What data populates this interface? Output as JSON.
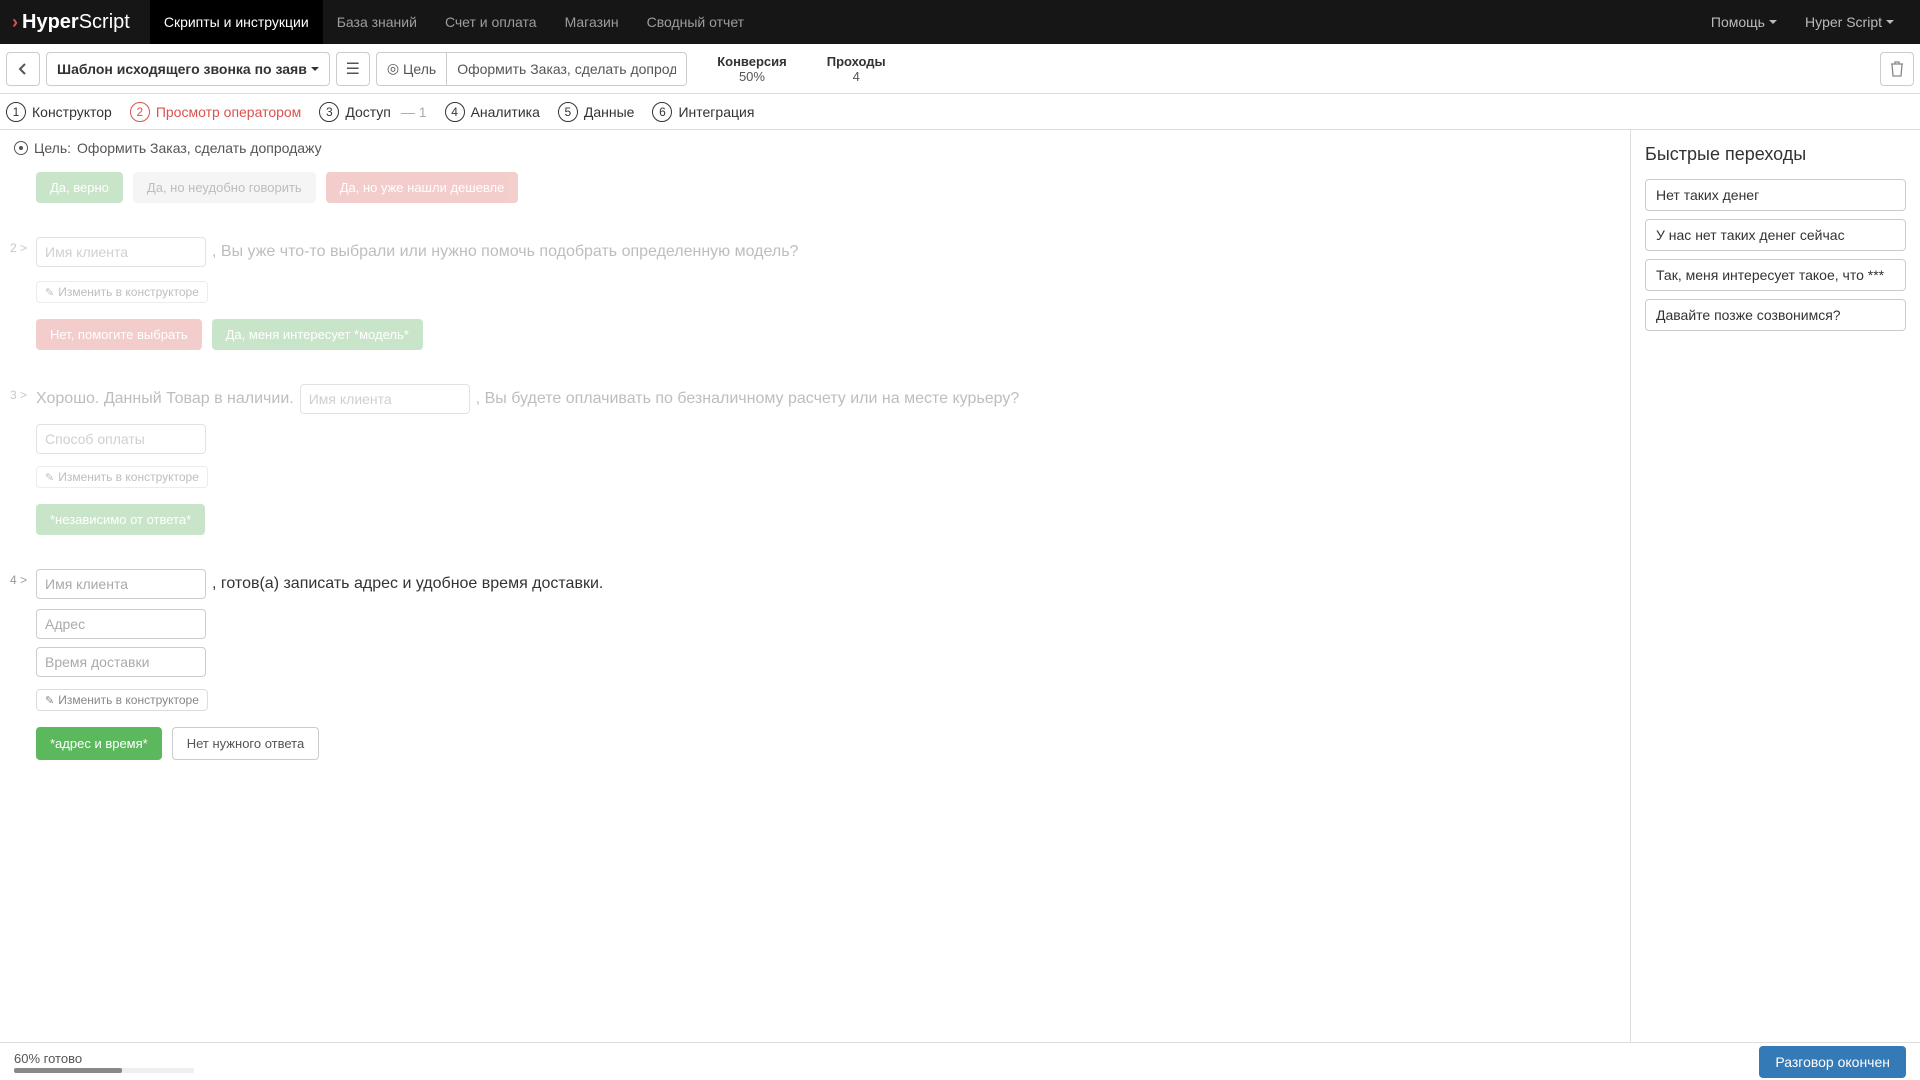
{
  "nav": {
    "logo_bold": "Hyper",
    "logo_light": "Script",
    "items": [
      "Скрипты и инструкции",
      "База знаний",
      "Счет и оплата",
      "Магазин",
      "Сводный отчет"
    ],
    "help": "Помощь",
    "user": "Hyper Script"
  },
  "toolbar": {
    "template_name": "Шаблон исходящего звонка по заяв",
    "goal_label": "Цель",
    "goal_value": "Оформить Заказ, сделать допродажу",
    "stats": {
      "conversion_label": "Конверсия",
      "conversion_value": "50%",
      "passes_label": "Проходы",
      "passes_value": "4"
    }
  },
  "tabs": [
    {
      "num": "1",
      "label": "Конструктор"
    },
    {
      "num": "2",
      "label": "Просмотр оператором"
    },
    {
      "num": "3",
      "label": "Доступ",
      "suffix": "— 1"
    },
    {
      "num": "4",
      "label": "Аналитика"
    },
    {
      "num": "5",
      "label": "Данные"
    },
    {
      "num": "6",
      "label": "Интеграция"
    }
  ],
  "goal_line": {
    "prefix": "Цель:",
    "text": "Оформить Заказ, сделать допродажу"
  },
  "steps": {
    "s1": {
      "answers": [
        {
          "label": "Да, верно",
          "cls": "ans-green-faded"
        },
        {
          "label": "Да, но неудобно говорить",
          "cls": "ans-light"
        },
        {
          "label": "Да, но уже нашли дешевле",
          "cls": "ans-red-faded"
        }
      ]
    },
    "s2": {
      "num": "2 >",
      "ph_name": "Имя клиента",
      "text": ", Вы уже что-то выбрали или нужно помочь подобрать определенную модель?",
      "edit": "Изменить в конструкторе",
      "answers": [
        {
          "label": "Нет, помогите выбрать",
          "cls": "ans-red-faded"
        },
        {
          "label": "Да, меня интересует *модель*",
          "cls": "ans-green-faded"
        }
      ]
    },
    "s3": {
      "num": "3 >",
      "text_before": "Хорошо. Данный Товар в наличии.",
      "ph_name": "Имя клиента",
      "text_after": ", Вы будете оплачивать по безналичному расчету или на месте курьеру?",
      "ph_pay": "Способ оплаты",
      "edit": "Изменить в конструкторе",
      "answers": [
        {
          "label": "*независимо от ответа*",
          "cls": "ans-green-faded"
        }
      ]
    },
    "s4": {
      "num": "4 >",
      "ph_name": "Имя клиента",
      "text": ", готов(а) записать адрес и удобное время доставки.",
      "ph_addr": "Адрес",
      "ph_time": "Время доставки",
      "edit": "Изменить в конструкторе",
      "answers": [
        {
          "label": "*адрес и время*",
          "cls": "ans-green"
        },
        {
          "label": "Нет нужного ответа",
          "cls": "ans-gray"
        }
      ]
    }
  },
  "sidebar": {
    "title": "Быстрые переходы",
    "items": [
      "Нет таких денег",
      "У нас нет таких денег сейчас",
      "Так, меня интересует такое, что ***",
      "Давайте позже созвонимся?"
    ]
  },
  "footer": {
    "progress_text": "60% готово",
    "progress_pct": 60,
    "finish": "Разговор окончен"
  }
}
